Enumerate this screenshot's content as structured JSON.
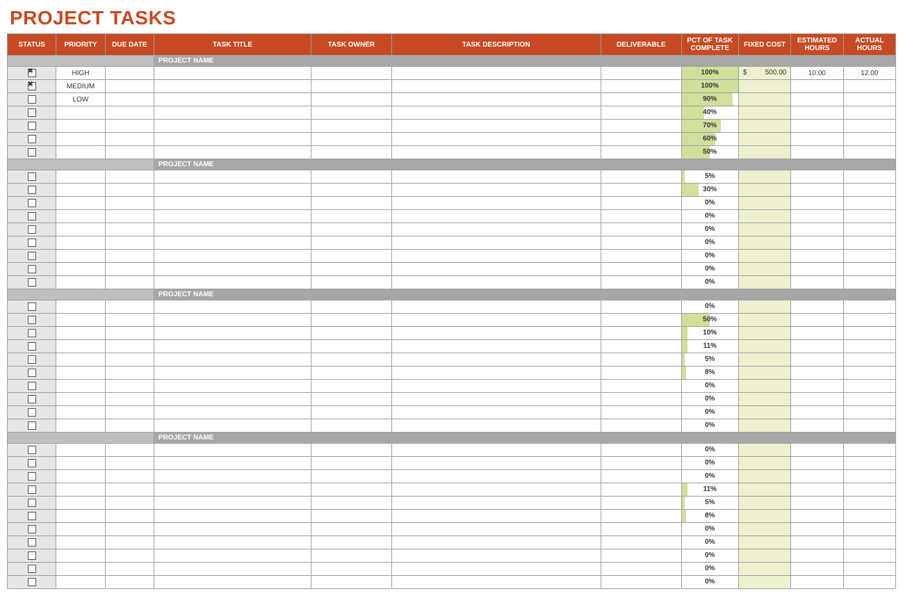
{
  "title": "PROJECT TASKS",
  "columns": {
    "status": "STATUS",
    "priority": "PRIORITY",
    "due": "DUE DATE",
    "title": "TASK TITLE",
    "owner": "TASK OWNER",
    "desc": "TASK DESCRIPTION",
    "deliverable": "DELIVERABLE",
    "pct": "PCT OF TASK COMPLETE",
    "cost": "FIXED COST",
    "eh": "ESTIMATED HOURS",
    "ah": "ACTUAL HOURS"
  },
  "money_symbol": "$",
  "groups": [
    {
      "name": "PROJECT NAME",
      "rows": [
        {
          "checked": true,
          "priority": "HIGH",
          "pct": 100,
          "cost": "500.00",
          "eh": "10.00",
          "ah": "12.00"
        },
        {
          "checked": true,
          "priority": "MEDIUM",
          "pct": 100
        },
        {
          "checked": false,
          "priority": "LOW",
          "pct": 90
        },
        {
          "checked": false,
          "pct": 40
        },
        {
          "checked": false,
          "pct": 70
        },
        {
          "checked": false,
          "pct": 60
        },
        {
          "checked": false,
          "pct": 50
        }
      ]
    },
    {
      "name": "PROJECT NAME",
      "rows": [
        {
          "checked": false,
          "pct": 5
        },
        {
          "checked": false,
          "pct": 30
        },
        {
          "checked": false,
          "pct": 0
        },
        {
          "checked": false,
          "pct": 0
        },
        {
          "checked": false,
          "pct": 0
        },
        {
          "checked": false,
          "pct": 0
        },
        {
          "checked": false,
          "pct": 0
        },
        {
          "checked": false,
          "pct": 0
        },
        {
          "checked": false,
          "pct": 0
        }
      ]
    },
    {
      "name": "PROJECT NAME",
      "rows": [
        {
          "checked": false,
          "pct": 0
        },
        {
          "checked": false,
          "pct": 50
        },
        {
          "checked": false,
          "pct": 10
        },
        {
          "checked": false,
          "pct": 11
        },
        {
          "checked": false,
          "pct": 5
        },
        {
          "checked": false,
          "pct": 8
        },
        {
          "checked": false,
          "pct": 0
        },
        {
          "checked": false,
          "pct": 0
        },
        {
          "checked": false,
          "pct": 0
        },
        {
          "checked": false,
          "pct": 0
        }
      ]
    },
    {
      "name": "PROJECT NAME",
      "rows": [
        {
          "checked": false,
          "pct": 0
        },
        {
          "checked": false,
          "pct": 0
        },
        {
          "checked": false,
          "pct": 0
        },
        {
          "checked": false,
          "pct": 11
        },
        {
          "checked": false,
          "pct": 5
        },
        {
          "checked": false,
          "pct": 8
        },
        {
          "checked": false,
          "pct": 0
        },
        {
          "checked": false,
          "pct": 0
        },
        {
          "checked": false,
          "pct": 0
        },
        {
          "checked": false,
          "pct": 0
        },
        {
          "checked": false,
          "pct": 0
        }
      ]
    }
  ]
}
